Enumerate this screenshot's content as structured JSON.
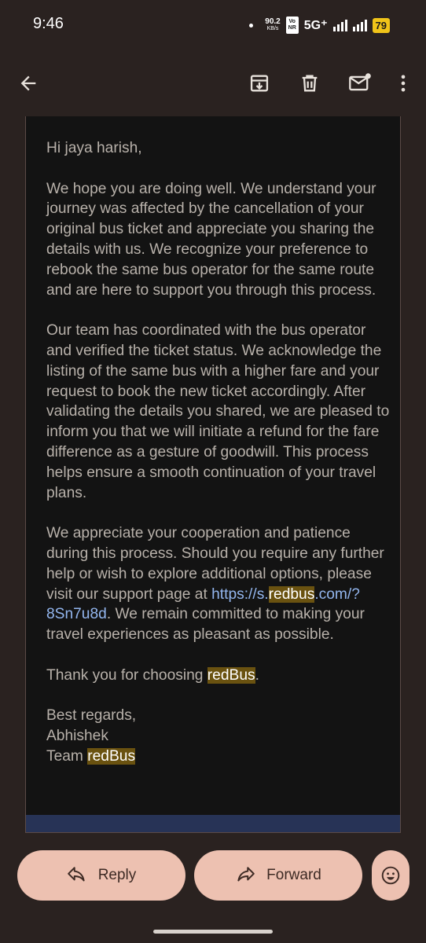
{
  "status_bar": {
    "time": "9:46",
    "net_speed": "90.2",
    "net_speed_unit": "KB/s",
    "volte_top": "Vo",
    "volte_bottom": "NR",
    "network": "5G⁺",
    "battery": "79"
  },
  "toolbar": {
    "icons": [
      "back-arrow-icon",
      "archive-icon",
      "delete-icon",
      "mark-unread-icon",
      "more-vert-icon"
    ]
  },
  "email": {
    "greeting": "Hi jaya harish,",
    "p1": "We hope you are doing well. We understand your journey was affected by the cancellation of your original bus ticket and appreciate you sharing the details with us. We recognize your preference to rebook the same bus operator for the same route and are here to support you through this process.",
    "p2": "Our team has coordinated with the bus operator and verified the ticket status. We acknowledge the listing of the same bus with a higher fare and your request to book the new ticket accordingly. After validating the details you shared, we are pleased to inform you that we will initiate a refund for the fare difference as a gesture of goodwill. This process helps ensure a smooth continuation of your travel plans.",
    "p3_before": "We appreciate your cooperation and patience during this process. Should you require any further help or wish to explore additional options, please visit our support page at ",
    "link_prefix": "https://s.",
    "link_highlight": "redbus",
    "link_suffix": ".com/?8Sn7u8d",
    "p3_after": ". We remain committed to making your travel experiences as pleasant as possible.",
    "thanks_before": "Thank you for choosing ",
    "thanks_highlight": "redBus",
    "thanks_after": ".",
    "closing": "Best regards,",
    "sender": "Abhishek",
    "team_prefix": "Team ",
    "team_highlight": "redBus"
  },
  "actions": {
    "reply_label": "Reply",
    "forward_label": "Forward"
  },
  "colors": {
    "highlight": "#6a5210",
    "link": "#93b6ee",
    "button": "#edc1b1",
    "background": "#2a2220"
  }
}
